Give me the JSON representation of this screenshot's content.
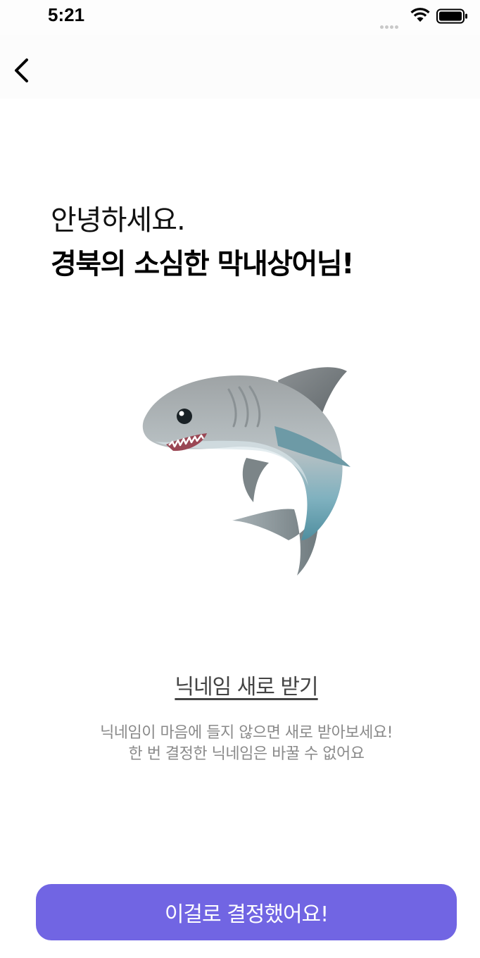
{
  "status_bar": {
    "time": "5:21"
  },
  "greeting": "안녕하세요.",
  "nickname_title": "경북의 소심한 막내상어님!",
  "avatar": {
    "icon": "shark-icon"
  },
  "renew_link_label": "닉네임 새로 받기",
  "hint_line_1": "닉네임이 마음에 들지 않으면 새로 받아보세요!",
  "hint_line_2": "한 번 결정한 닉네임은 바꿀 수 없어요",
  "confirm_button_label": "이걸로 결정했어요!",
  "colors": {
    "accent": "#7165e3",
    "hint_text": "#8a8a8a",
    "link_text": "#444444"
  }
}
